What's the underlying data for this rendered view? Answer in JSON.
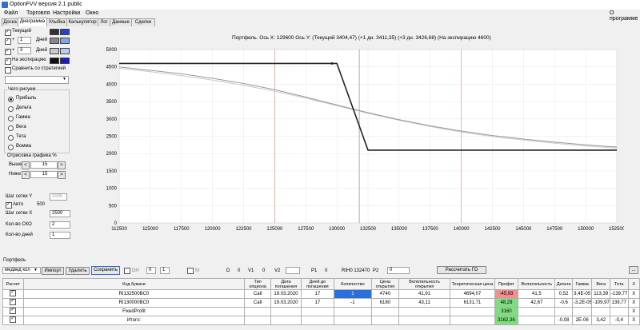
{
  "window": {
    "title": "OptionFVV версия 2.1 public"
  },
  "menu": {
    "file": "Файл",
    "trading": "Торговля",
    "settings": "Настройки",
    "window": "Окно",
    "about": "О программе"
  },
  "tabs": [
    "Доска",
    "Диаграмма",
    "Улыбка",
    "Калькулятор",
    "Лог",
    "Данные",
    "Сделки"
  ],
  "left_panel": {
    "rows": [
      {
        "label": "Текущий"
      },
      {
        "prefix": "+",
        "value": "1",
        "label": "Дней"
      },
      {
        "prefix": "+",
        "value": "3",
        "label": "Дней"
      },
      {
        "label": "На экспирацию"
      }
    ],
    "compare_label": "Сравнить со стратегией",
    "what_to_draw": "Чего рисуем",
    "options": [
      "Прибыль",
      "Дельта",
      "Гамма",
      "Вега",
      "Тета",
      "Вомма"
    ],
    "drawing_label": "Отрисовка графика %",
    "above_label": "Выше",
    "above_value": "15",
    "below_label": "Ниже",
    "below_value": "15",
    "grid_y_label": "Шаг сетки Y",
    "grid_y_value": "1000",
    "auto_label": "Авто",
    "auto_value": "500",
    "grid_x_label": "Шаг сетки X",
    "grid_x_value": "2500",
    "sko_label": "Кол-во СКО",
    "sko_value": "2",
    "days_label": "Кол-во дней",
    "days_value": "1"
  },
  "chart_data": {
    "type": "line",
    "title": "Портфель. Ось X: 129600 Ось Y: (Текущий 3404,47) (+1 дн. 3411,35) (+3 дн. 3426,68) (На экспирацию 4600)",
    "xlim": [
      112500,
      152500
    ],
    "ylim": [
      0,
      5000
    ],
    "x_ticks": [
      112500,
      115000,
      117500,
      120000,
      122500,
      125000,
      127500,
      130000,
      132500,
      135000,
      137500,
      140000,
      142500,
      145000,
      147500,
      150000,
      152500
    ],
    "y_ticks": [
      0,
      500,
      1000,
      1500,
      2000,
      2500,
      3000,
      3500,
      4000,
      4500,
      5000
    ],
    "current_x": 131800,
    "red_lines": [
      125000,
      140000
    ],
    "series": [
      {
        "color": "#222222",
        "width": 1.6,
        "x": [
          112500,
          129600,
          130000,
          132500,
          152500
        ],
        "y": [
          4600,
          4600,
          4600,
          2100,
          2100
        ]
      },
      {
        "color": "#999999",
        "width": 1.0,
        "x": [
          112500,
          115000,
          117500,
          120000,
          122500,
          125000,
          127500,
          130000,
          132500,
          135000,
          137500,
          140000,
          142500,
          145000,
          147500,
          150000,
          152500
        ],
        "y": [
          4500,
          4400,
          4300,
          4170,
          4020,
          3840,
          3630,
          3400,
          3180,
          2980,
          2800,
          2650,
          2520,
          2420,
          2330,
          2250,
          2190
        ]
      },
      {
        "color": "#c8c8c8",
        "width": 1.0,
        "x": [
          112500,
          115000,
          117500,
          120000,
          122500,
          125000,
          127500,
          130000,
          132500,
          135000,
          137500,
          140000,
          142500,
          145000,
          147500,
          150000,
          152500
        ],
        "y": [
          4460,
          4360,
          4250,
          4120,
          3970,
          3800,
          3600,
          3380,
          3160,
          2960,
          2780,
          2620,
          2490,
          2390,
          2300,
          2220,
          2160
        ]
      }
    ]
  },
  "portfolio": {
    "label": "Портфель",
    "name": "медвед кол",
    "import": "Импорт",
    "delete": "Удалить",
    "save": "Сохранить",
    "dh": "DH",
    "dh_val1": "0",
    "dh_val2": "1",
    "m": "M",
    "d_label": "D",
    "d_val": "0",
    "v1_label": "V1",
    "v1_val": "0",
    "v2_label": "V2",
    "p1_label": "P1",
    "p1_val": "0",
    "riho": "RIH0 132470",
    "p2_label": "P2",
    "p2_val": "0",
    "calc": "Рассчитать ГО",
    "dots": "..."
  },
  "table": {
    "headers": [
      "Расчет",
      "Код бумаги",
      "Тип опциона",
      "Дата погашения",
      "Дней до погашения",
      "Количество",
      "Цена открытия",
      "Волатильность открытия",
      "Теоретическая цена",
      "Профит",
      "Волатильность",
      "Дельта",
      "Гамма",
      "Вега",
      "Тета",
      "X"
    ],
    "rows": [
      [
        "",
        "RI132500BC0",
        "Call",
        "19.03.2020",
        "17",
        "1",
        "4740",
        "41,91",
        "4694,07",
        "-45,93",
        "41,5",
        "0,52",
        "3,4E-05",
        "113,39",
        "-139,77",
        "X"
      ],
      [
        "",
        "RI130000BC0",
        "Call",
        "19.03.2020",
        "17",
        "-1",
        "6180",
        "43,11",
        "6131,71",
        "48,29",
        "42,67",
        "-0,6",
        "-3,2E-05",
        "-109,97",
        "139,77",
        "X"
      ],
      [
        "",
        "FixedProfit",
        "",
        "",
        "",
        "",
        "",
        "",
        "",
        "3160",
        "",
        "",
        "",
        "",
        "",
        "X"
      ],
      [
        "",
        "Итого:",
        "",
        "",
        "",
        "",
        "",
        "",
        "",
        "3162,36",
        "",
        "-0,08",
        "2E-06",
        "3,42",
        "-0,4",
        "X"
      ]
    ]
  }
}
